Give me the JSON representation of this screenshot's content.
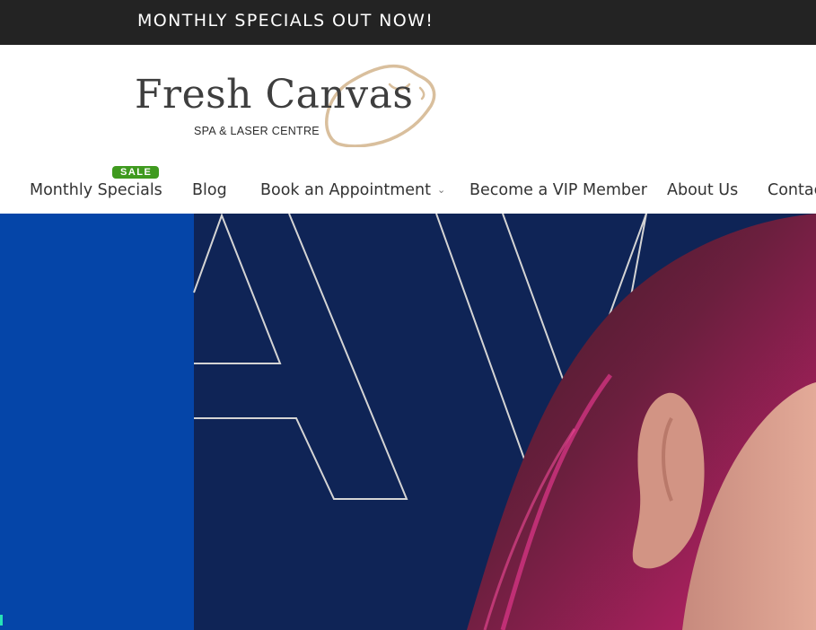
{
  "promo": {
    "text": "MONTHLY SPECIALS OUT NOW!"
  },
  "logo": {
    "title": "Fresh Canvas",
    "subtitle": "SPA & LASER CENTRE"
  },
  "nav": {
    "items": [
      {
        "label": "Monthly Specials",
        "badge": "SALE"
      },
      {
        "label": "Blog"
      },
      {
        "label": "Book an Appointment",
        "has_dropdown": true
      },
      {
        "label": "Become a VIP Member"
      },
      {
        "label": "About Us"
      },
      {
        "label": "Contac"
      }
    ]
  },
  "colors": {
    "promo_bg": "#232323",
    "sale_badge": "#3f9a1f",
    "hero_blue": "#0545a8",
    "hero_navy": "#0f2456",
    "logo_swoosh": "#d9bf9d",
    "accent": "#27e2b6"
  },
  "icons": {
    "dropdown": "chevron-down-icon"
  }
}
